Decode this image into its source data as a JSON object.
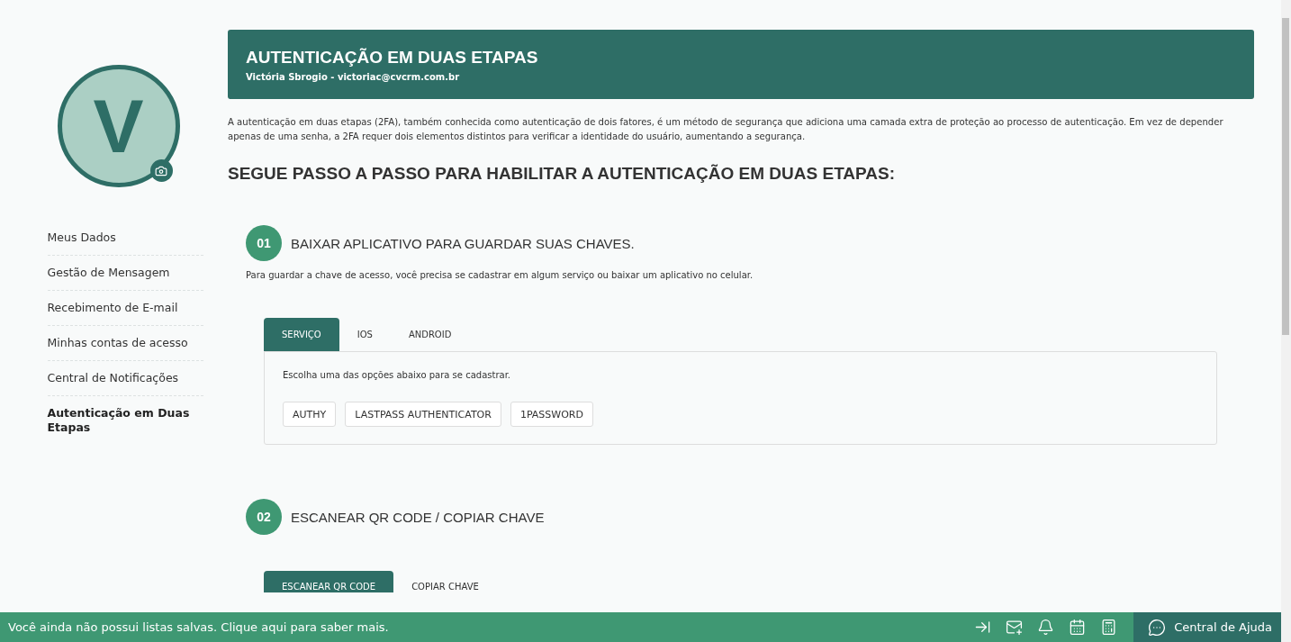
{
  "profile": {
    "initial": "V"
  },
  "sidebar": {
    "items": [
      {
        "label": "Meus Dados",
        "selected": false
      },
      {
        "label": "Gestão de Mensagem",
        "selected": false
      },
      {
        "label": "Recebimento de E-mail",
        "selected": false
      },
      {
        "label": "Minhas contas de acesso",
        "selected": false
      },
      {
        "label": "Central de Notificações",
        "selected": false
      },
      {
        "label": "Autenticação em Duas Etapas",
        "selected": true
      }
    ]
  },
  "header": {
    "title": "AUTENTICAÇÃO EM DUAS ETAPAS",
    "subtitle": "Victória Sbrogio - victoriac@cvcrm.com.br"
  },
  "intro": "A autenticação em duas etapas (2FA), também conhecida como autenticação de dois fatores, é um método de segurança que adiciona uma camada extra de proteção ao processo de autenticação. Em vez de depender apenas de uma senha, a 2FA requer dois elementos distintos para verificar a identidade do usuário, aumentando a segurança.",
  "steps_title": "SEGUE PASSO A PASSO PARA HABILITAR A AUTENTICAÇÃO EM DUAS ETAPAS:",
  "steps": [
    {
      "number": "01",
      "title": "BAIXAR APLICATIVO PARA GUARDAR SUAS CHAVES.",
      "description": "Para guardar a chave de acesso, você precisa se cadastrar em algum serviço ou baixar um aplicativo no celular.",
      "tabs": [
        {
          "label": "SERVIÇO",
          "selected": true
        },
        {
          "label": "IOS",
          "selected": false
        },
        {
          "label": "ANDROID",
          "selected": false
        }
      ],
      "panel": {
        "text": "Escolha uma das opções abaixo para se cadastrar.",
        "options": [
          "AUTHY",
          "LASTPASS AUTHENTICATOR",
          "1PASSWORD"
        ]
      }
    },
    {
      "number": "02",
      "title": "ESCANEAR QR CODE / COPIAR CHAVE",
      "tabs": [
        {
          "label": "ESCANEAR QR CODE",
          "selected": true
        },
        {
          "label": "COPIAR CHAVE",
          "selected": false
        }
      ]
    }
  ],
  "bottom_bar": {
    "message": "Você ainda não possui listas salvas. Clique aqui para saber mais.",
    "help": "Central de Ajuda"
  }
}
